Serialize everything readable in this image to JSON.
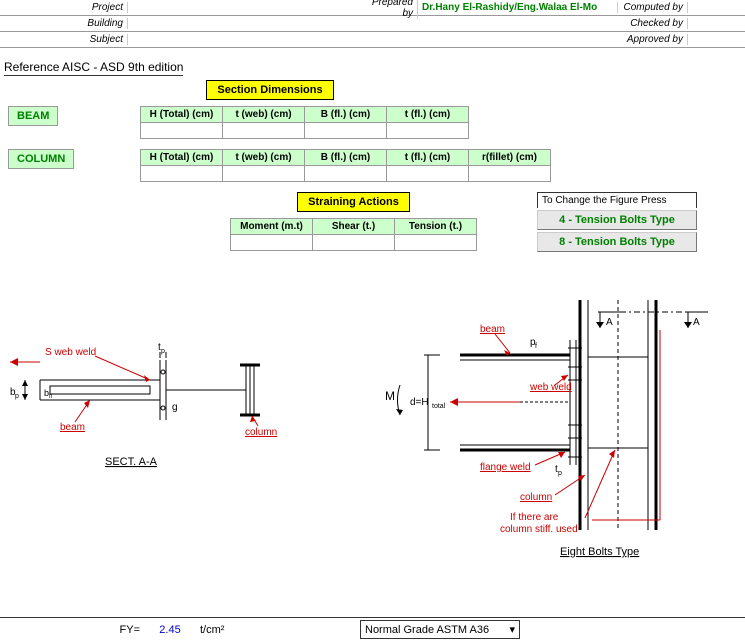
{
  "header": {
    "project_label": "Project",
    "building_label": "Building",
    "subject_label": "Subject",
    "prepared_by_label": "Prepared by",
    "prepared_by_value": "Dr.Hany El-Rashidy/Eng.Walaa El-Mo",
    "computed_by_label": "Computed by",
    "checked_by_label": "Checked by",
    "approved_by_label": "Approved by"
  },
  "reference": "Reference AISC - ASD 9th edition",
  "sections": {
    "dimensions_title": "Section Dimensions",
    "straining_title": "Straining Actions"
  },
  "beam": {
    "label": "BEAM",
    "headers": [
      "H (Total) (cm)",
      "t (web) (cm)",
      "B (fl.) (cm)",
      "t (fl.) (cm)"
    ]
  },
  "column": {
    "label": "COLUMN",
    "headers": [
      "H (Total) (cm)",
      "t (web) (cm)",
      "B (fl.) (cm)",
      "t (fl.) (cm)",
      "r(fillet) (cm)"
    ]
  },
  "straining": {
    "headers": [
      "Moment (m.t)",
      "Shear (t.)",
      "Tension (t.)"
    ]
  },
  "figure_change": {
    "title": "To Change the Figure Press",
    "btn4": "4 - Tension Bolts Type",
    "btn8": "8 - Tension Bolts Type"
  },
  "diagram": {
    "s_web_weld": "S web weld",
    "tp": "tp",
    "bp": "bp",
    "bfl": "bfl",
    "g": "g",
    "beam": "beam",
    "column": "column",
    "sect_aa": "SECT. A-A",
    "M": "M",
    "d_htotal": "d=Htotal",
    "web_weld": "web weld",
    "flange_weld": "flange weld",
    "pf": "pf",
    "A": "A",
    "stiff_note": "If there are\ncolumn stiff. used",
    "eight_bolts": "Eight Bolts Type"
  },
  "footer": {
    "fy_label": "FY=",
    "fy_value": "2.45",
    "fy_unit": "t/cm²",
    "grade": "Normal Grade ASTM A36"
  }
}
